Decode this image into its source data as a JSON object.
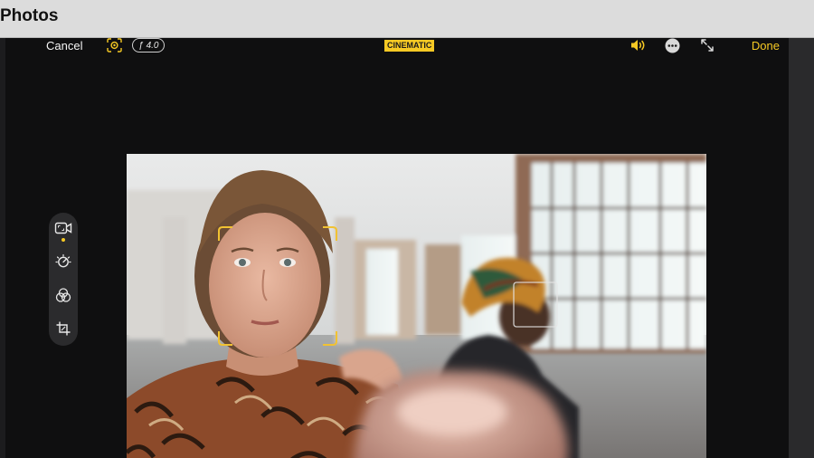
{
  "window": {
    "title": "Photos"
  },
  "toolbar": {
    "cancel_label": "Cancel",
    "aperture": "4.0",
    "mode_badge": "CINEMATIC",
    "done_label": "Done"
  },
  "icons": {
    "focus": "focus-viewfinder-icon",
    "aperture": "f-stop-icon",
    "speaker": "speaker-volume-icon",
    "more": "ellipsis-circle-icon",
    "expand": "expand-arrows-icon",
    "rail": [
      "video-icon",
      "adjust-dial-icon",
      "filters-icon",
      "crop-icon"
    ]
  },
  "colors": {
    "accent": "#f6c924",
    "focus_box_primary": "#f1c232",
    "focus_box_secondary": "#cfcfcf"
  }
}
